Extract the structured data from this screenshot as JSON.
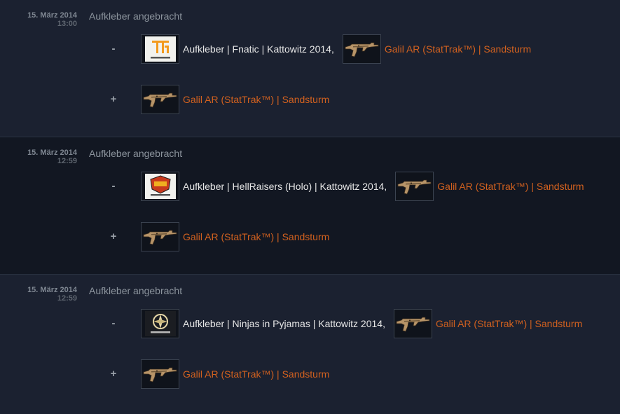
{
  "colors": {
    "background": "#1b2130",
    "background_alt": "#121722",
    "weapon_text": "#d2611f",
    "sticker_text": "#e6e6e6",
    "date_text": "#7f8792",
    "event_text": "#8b939c"
  },
  "entries": [
    {
      "date": "15. März 2014",
      "time": "13:00",
      "event": "Aufkleber angebracht",
      "removed_sign": "-",
      "added_sign": "+",
      "removed": {
        "sticker": "Aufkleber | Fnatic | Kattowitz 2014",
        "sticker_icon": "fnatic-sticker-icon",
        "comma": ",",
        "weapon": "Galil AR (StatTrak™) | Sandsturm"
      },
      "added": {
        "weapon": "Galil AR (StatTrak™) | Sandsturm"
      }
    },
    {
      "date": "15. März 2014",
      "time": "12:59",
      "event": "Aufkleber angebracht",
      "removed_sign": "-",
      "added_sign": "+",
      "removed": {
        "sticker": "Aufkleber | HellRaisers (Holo) | Kattowitz 2014",
        "sticker_icon": "hellraisers-sticker-icon",
        "comma": ",",
        "weapon": "Galil AR (StatTrak™) | Sandsturm"
      },
      "added": {
        "weapon": "Galil AR (StatTrak™) | Sandsturm"
      }
    },
    {
      "date": "15. März 2014",
      "time": "12:59",
      "event": "Aufkleber angebracht",
      "removed_sign": "-",
      "added_sign": "+",
      "removed": {
        "sticker": "Aufkleber | Ninjas in Pyjamas | Kattowitz 2014",
        "sticker_icon": "ninjas-in-pyjamas-sticker-icon",
        "comma": ",",
        "weapon": "Galil AR (StatTrak™) | Sandsturm"
      },
      "added": {
        "weapon": "Galil AR (StatTrak™) | Sandsturm"
      }
    }
  ]
}
